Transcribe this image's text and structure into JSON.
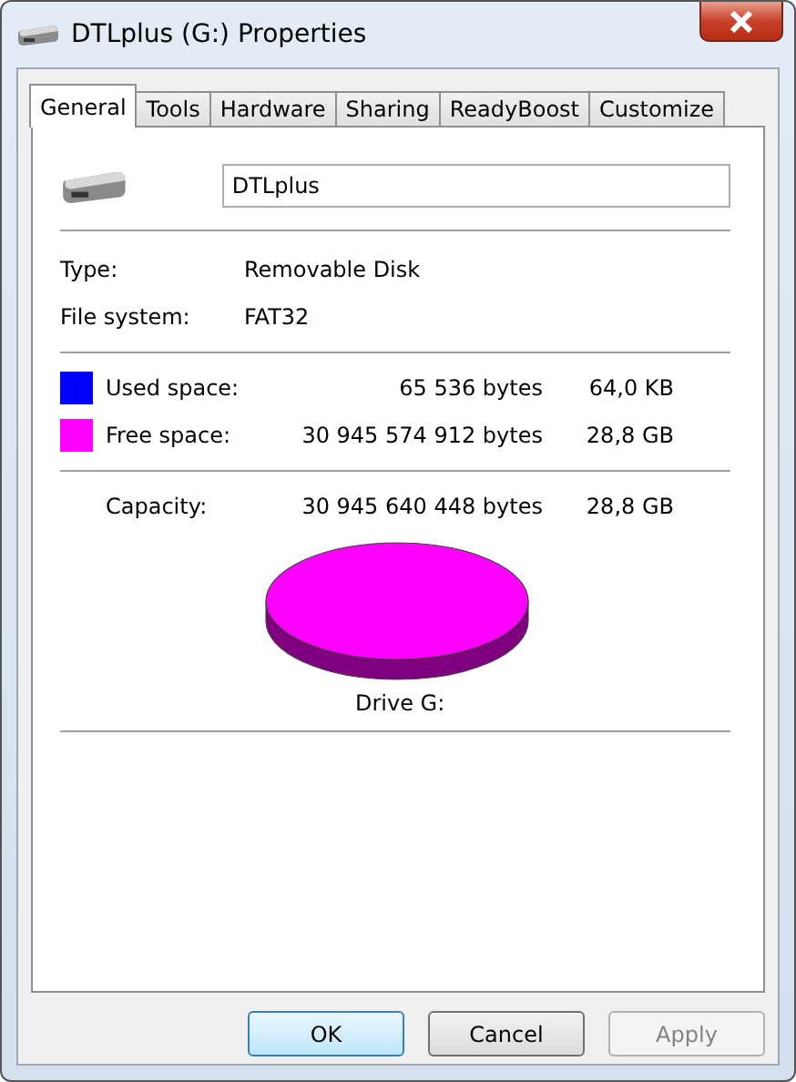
{
  "window": {
    "title": "DTLplus (G:) Properties"
  },
  "tabs": [
    {
      "label": "General",
      "selected": true
    },
    {
      "label": "Tools",
      "selected": false
    },
    {
      "label": "Hardware",
      "selected": false
    },
    {
      "label": "Sharing",
      "selected": false
    },
    {
      "label": "ReadyBoost",
      "selected": false
    },
    {
      "label": "Customize",
      "selected": false
    }
  ],
  "name_field": {
    "value": "DTLplus"
  },
  "info": [
    {
      "label": "Type:",
      "value": "Removable Disk"
    },
    {
      "label": "File system:",
      "value": "FAT32"
    }
  ],
  "space": [
    {
      "label": "Used space:",
      "bytes": "65 536 bytes",
      "size": "64,0 KB",
      "color": "#0000ff"
    },
    {
      "label": "Free space:",
      "bytes": "30 945 574 912 bytes",
      "size": "28,8 GB",
      "color": "#ff00ff"
    }
  ],
  "capacity": {
    "label": "Capacity:",
    "bytes": "30 945 640 448 bytes",
    "size": "28,8 GB"
  },
  "drive_label": "Drive G:",
  "buttons": [
    {
      "label": "OK",
      "default": true,
      "disabled": false
    },
    {
      "label": "Cancel",
      "default": false,
      "disabled": false
    },
    {
      "label": "Apply",
      "default": false,
      "disabled": true
    }
  ]
}
